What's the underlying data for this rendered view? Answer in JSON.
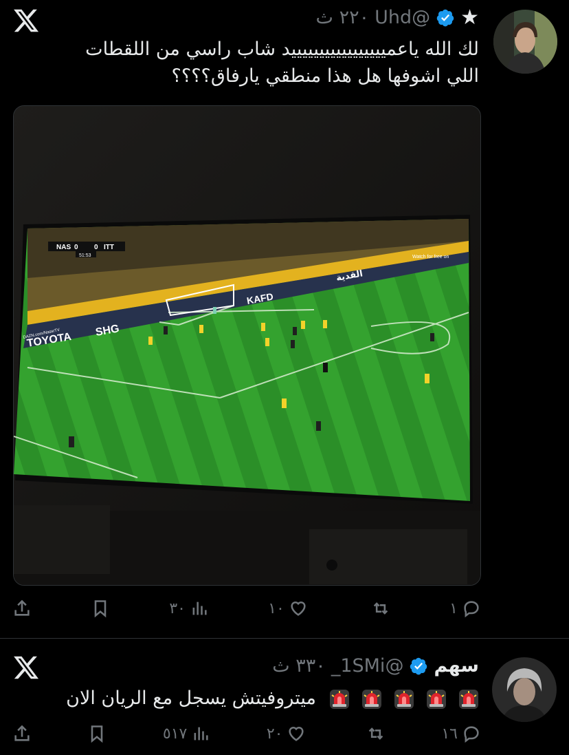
{
  "tweet1": {
    "display_name": "★",
    "handle": "@Uhd",
    "time": "٢٢٠ ث",
    "text_line1": "لك الله ياعميييييييييييييييييد شاب راسي من اللقطات",
    "text_line2": "اللي اشوفها هل هذا منطقي يارفاق؟؟؟؟",
    "scoreboard": {
      "home": "NAS",
      "home_score": "0",
      "away_score": "0",
      "away": "ITT",
      "clock": "51:53"
    },
    "ad_boards": [
      "TOYOTA",
      "SHG",
      "KAFD",
      "القدية",
      "Watch for free on",
      "DAZN.com/NassrTV"
    ],
    "stats": {
      "replies": "١",
      "reposts": "",
      "likes": "١٠",
      "views": "٣٠"
    }
  },
  "tweet2": {
    "display_name": "سهم",
    "handle": "@1SMi_",
    "time": "٣٣٠ ث",
    "text": "ميتروفيتش يسجل مع الريان الان",
    "siren_icon_count": 5,
    "stats": {
      "replies": "١٦",
      "reposts": "",
      "likes": "٢٠",
      "views": "٥١٧"
    }
  },
  "colors": {
    "background": "#000000",
    "text": "#e7e9ea",
    "muted": "#71767b",
    "verified": "#1d9bf0",
    "pitch": "#2f9b2c",
    "siren": "#e0242c"
  }
}
